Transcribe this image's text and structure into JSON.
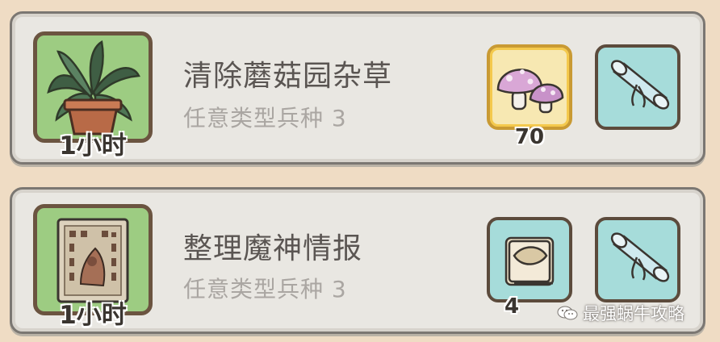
{
  "tasks": [
    {
      "image_icon": "potted-plant-icon",
      "duration": "1小时",
      "title": "清除蘑菇园杂草",
      "requirement": "任意类型兵种 3",
      "rewards": [
        {
          "icon": "mushroom-icon",
          "count": "70",
          "frame": "gold"
        },
        {
          "icon": "scroll-icon",
          "count": "",
          "frame": "teal"
        }
      ]
    },
    {
      "image_icon": "intel-document-icon",
      "duration": "1小时",
      "title": "整理魔神情报",
      "requirement": "任意类型兵种 3",
      "rewards": [
        {
          "icon": "book-icon",
          "count": "4",
          "frame": "teal"
        },
        {
          "icon": "scroll-icon",
          "count": "",
          "frame": "teal"
        }
      ]
    }
  ],
  "watermark": {
    "icon": "wechat-icon",
    "text": "最强蜗牛攻略"
  },
  "colors": {
    "background": "#efdcc4",
    "card": "#e9e7e2",
    "thumb_green": "#9dcc82",
    "reward_gold": "#f7e8b2",
    "reward_teal": "#a6dcda"
  }
}
